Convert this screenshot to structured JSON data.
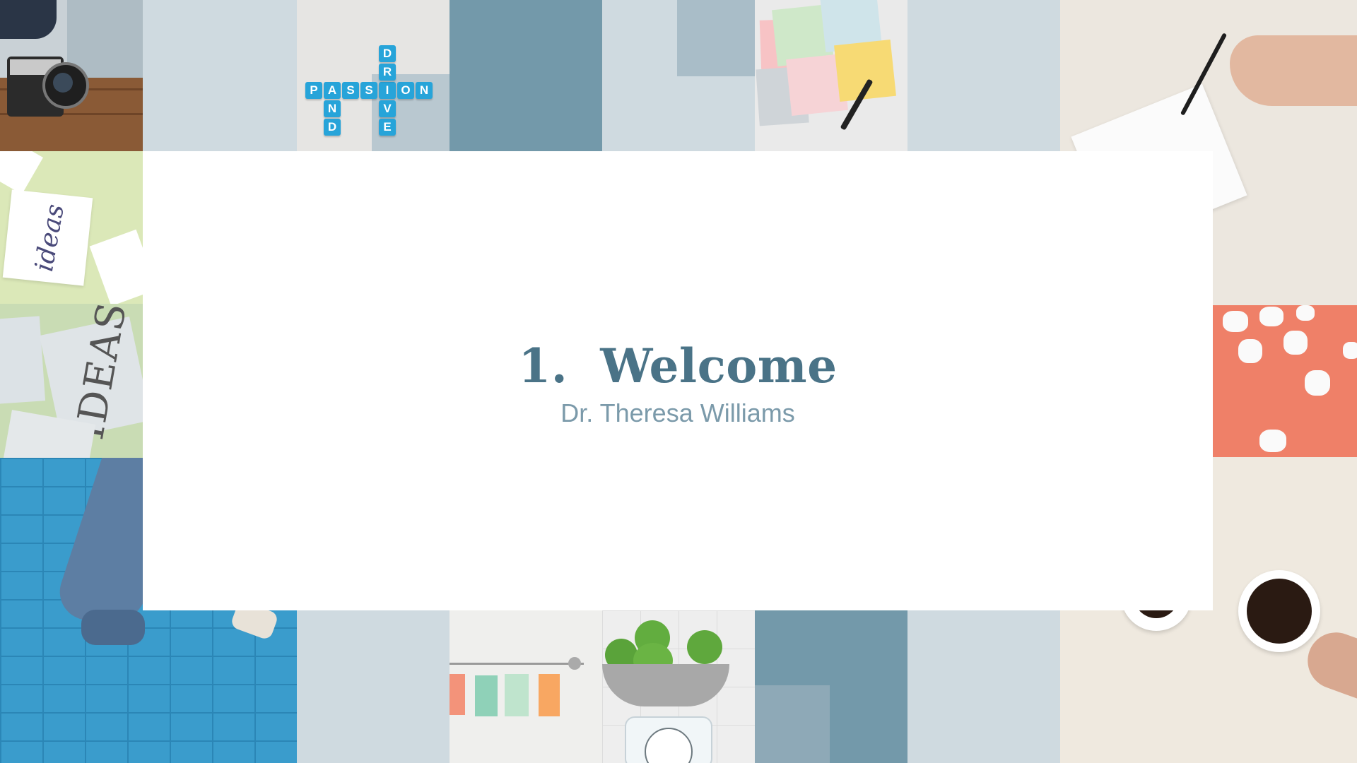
{
  "slide": {
    "title_number": "1.",
    "title_text": "Welcome",
    "subtitle": "Dr. Theresa Williams"
  },
  "photos": {
    "scrabble_across": [
      "P",
      "A",
      "S",
      "S",
      "I",
      "O",
      "N"
    ],
    "scrabble_down": [
      "D",
      "R",
      "I",
      "V",
      "E"
    ],
    "scrabble_and": [
      "A",
      "N",
      "D"
    ],
    "ideas_card": "ideas",
    "ideas_big": "IDEAS"
  },
  "colors": {
    "accent": "#4a7387",
    "subtitle": "#7b9aaa",
    "pale_blue": "#cfdae0",
    "steel_blue": "#7399aa",
    "coral": "#ef8068",
    "brick_blue": "#3a9ccc"
  }
}
